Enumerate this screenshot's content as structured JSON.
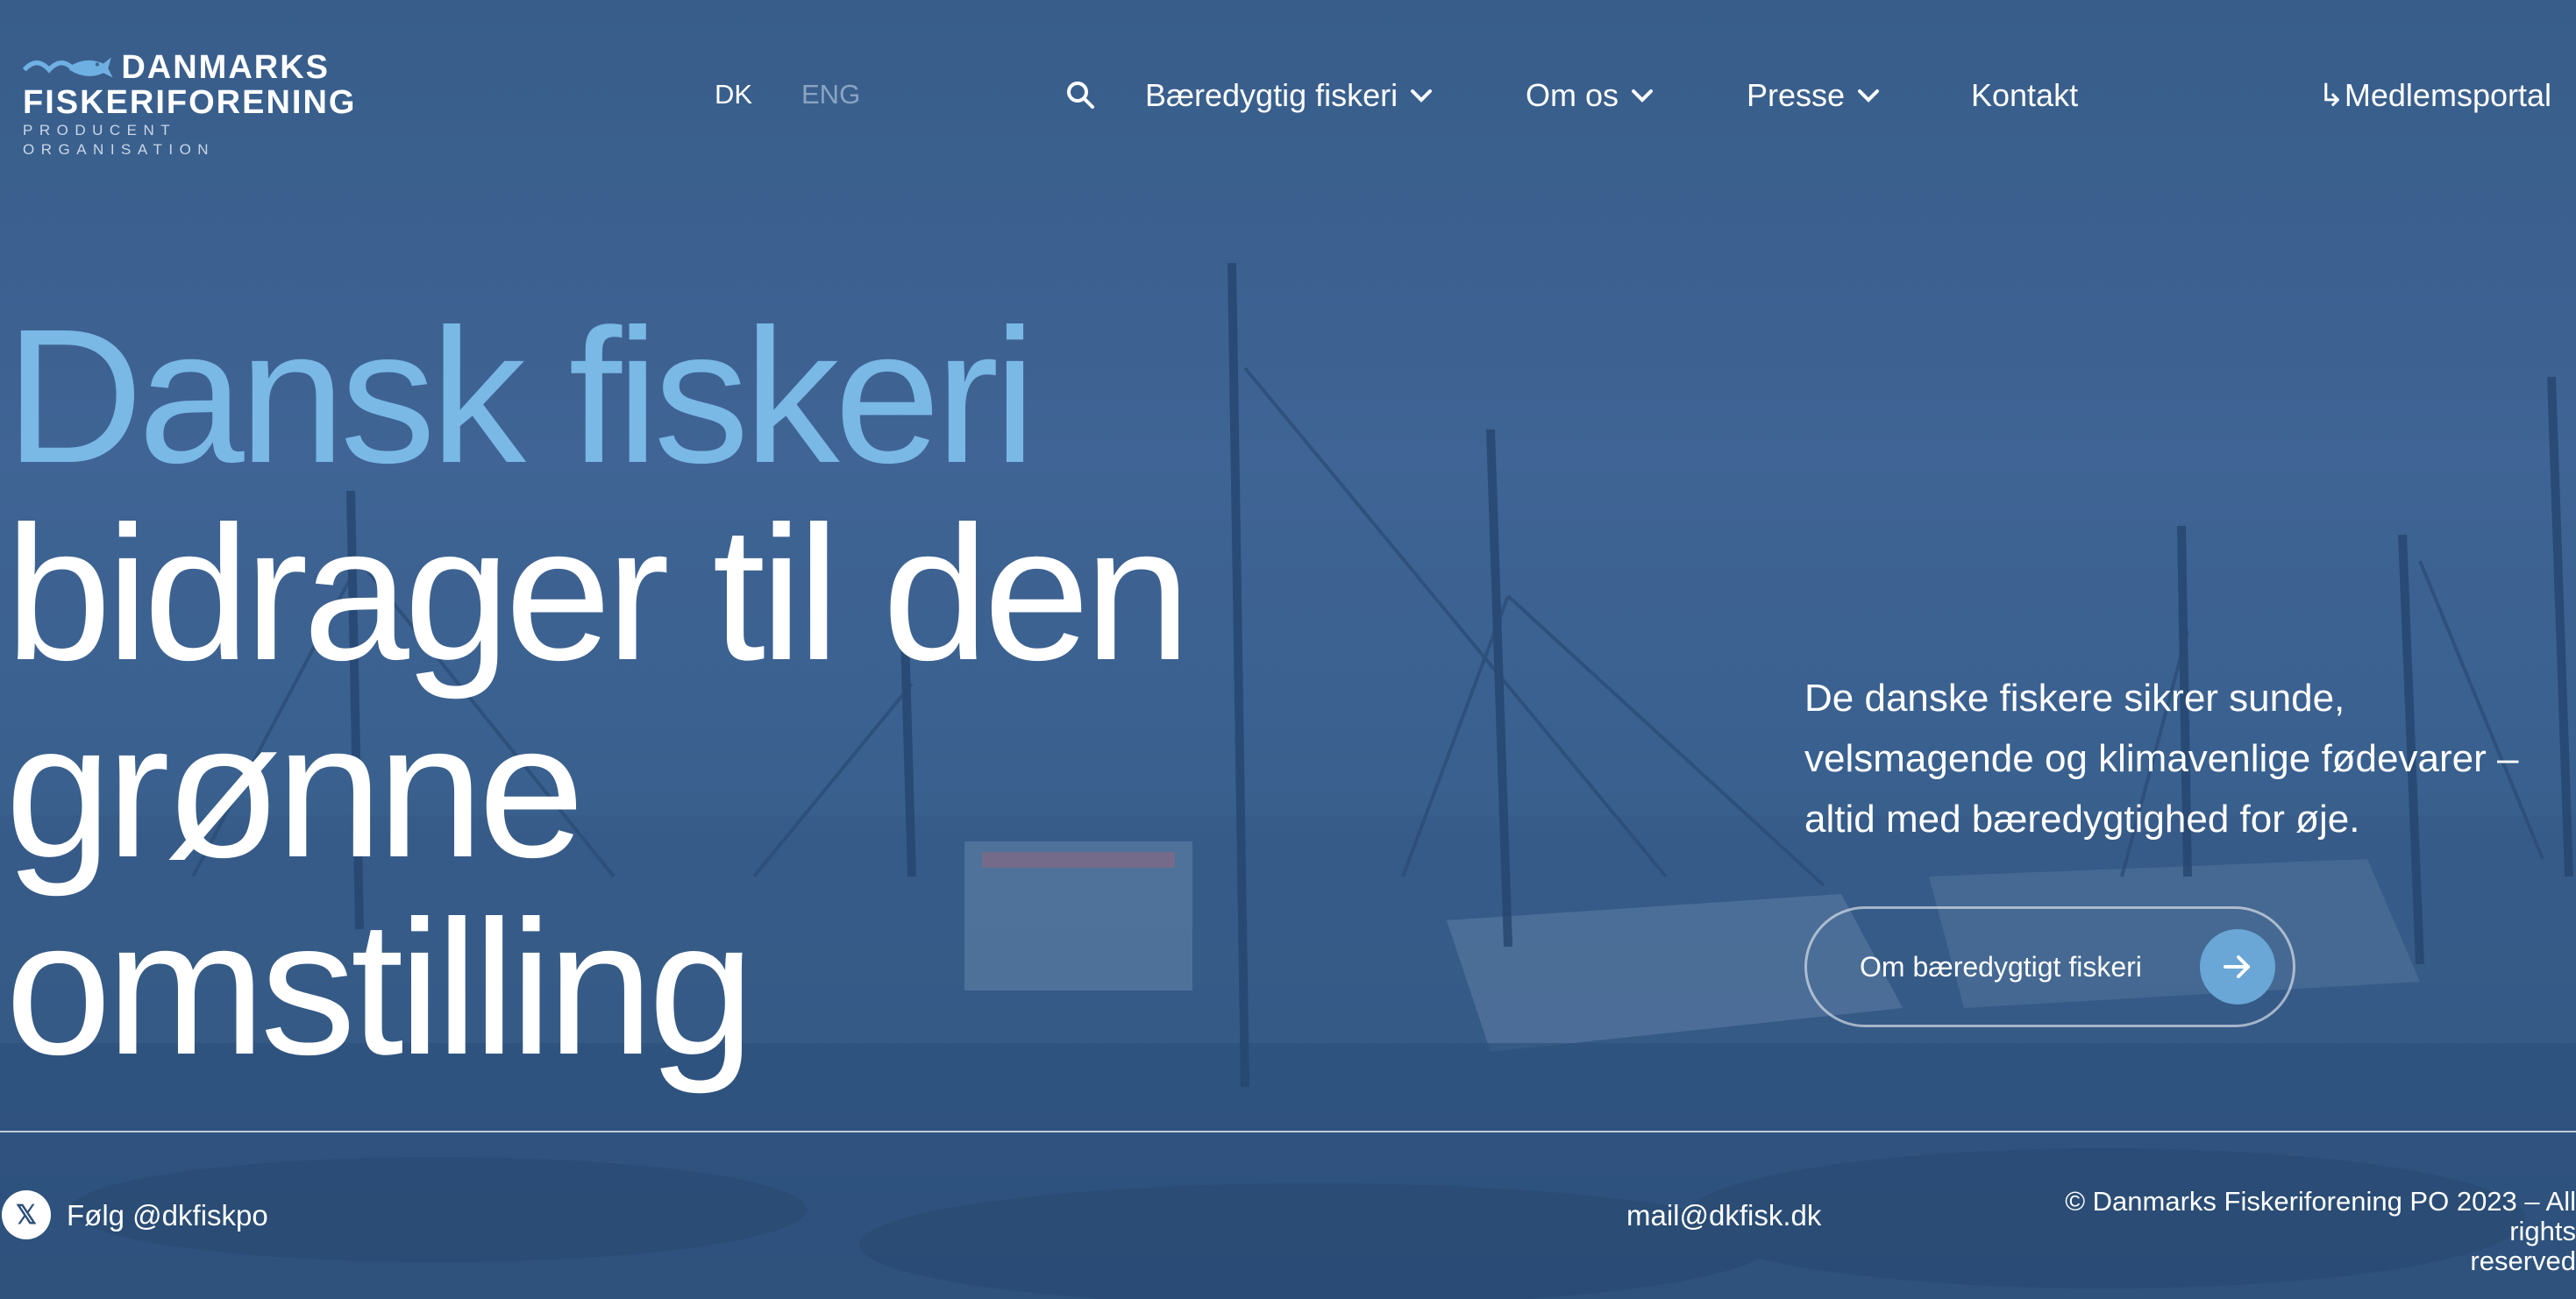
{
  "brand": {
    "name_line1": "DANMARKS",
    "name_line2": "FISKERIFORENING",
    "tagline": "PRODUCENT ORGANISATION",
    "accent_color": "#7ab8e6"
  },
  "header": {
    "languages": [
      "DK",
      "ENG"
    ],
    "active_language": "DK",
    "nav": [
      {
        "label": "Bæredygtig fiskeri",
        "has_dropdown": true
      },
      {
        "label": "Om os",
        "has_dropdown": true
      },
      {
        "label": "Presse",
        "has_dropdown": true
      },
      {
        "label": "Kontakt",
        "has_dropdown": false
      }
    ],
    "portal_label": "↳Medlemsportal",
    "icons": {
      "search": "search-icon",
      "dropdown": "chevron-down-icon"
    }
  },
  "hero": {
    "headline_line1": "Dansk fiskeri",
    "headline_line2": "bidrager til den",
    "headline_line3": "grønne",
    "headline_line4": "omstilling",
    "intro_line1": "De danske fiskere sikrer sunde,",
    "intro_line2": "velsmagende og klimavenlige fødevarer –",
    "intro_line3": "altid med bæredygtighed for øje.",
    "cta_label": "Om bæredygtigt fiskeri",
    "cta_icon": "arrow-right-icon"
  },
  "footer": {
    "x_icon_label": "𝕏",
    "follow_label": "Følg @dkfiskpo",
    "email": "mail@dkfisk.dk",
    "copyright_line1": "© Danmarks Fiskeriforening PO 2023 – All rights",
    "copyright_line2": "reserved"
  }
}
